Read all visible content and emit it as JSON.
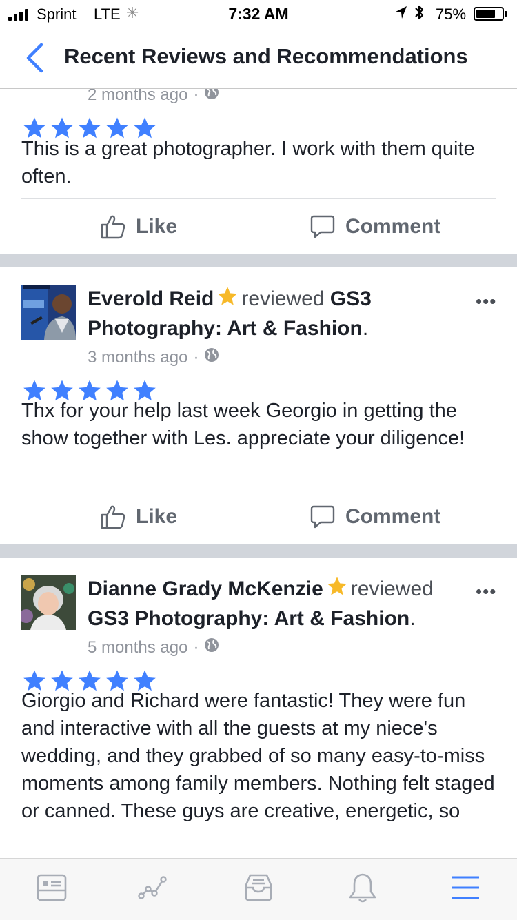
{
  "status_bar": {
    "carrier": "Sprint",
    "network": "LTE",
    "time": "7:32 AM",
    "battery_percent": "75%",
    "battery_level": 0.75,
    "icons": [
      "signal-icon",
      "activity-spinner-icon",
      "location-arrow-icon",
      "bluetooth-icon",
      "battery-icon"
    ]
  },
  "nav": {
    "title": "Recent Reviews and Recommendations",
    "back_icon": "chevron-left-icon"
  },
  "colors": {
    "accent": "#4080ff",
    "star_badge": "#f7b928",
    "separator": "#d1d5db",
    "muted_text": "#90949c",
    "action_text": "#616770"
  },
  "reviews": [
    {
      "time_ago": "2 months ago",
      "rating": 5,
      "text": "This is a great photographer. I work with them quite often.",
      "like_label": "Like",
      "comment_label": "Comment"
    },
    {
      "author": "Everold Reid",
      "verb": "reviewed",
      "page": "GS3 Photography: Art & Fashion",
      "time_ago": "3 months ago",
      "rating": 5,
      "text": "Thx for your help last week Georgio in getting the show together with Les. appreciate your diligence!",
      "like_label": "Like",
      "comment_label": "Comment"
    },
    {
      "author": "Dianne Grady McKenzie",
      "verb": "reviewed",
      "page": "GS3 Photography: Art & Fashion",
      "time_ago": "5 months ago",
      "rating": 5,
      "text": "Giorgio and Richard were fantastic! They were fun and interactive with all the guests at my niece's wedding, and they grabbed of so many easy-to-miss moments among family members. Nothing felt staged or canned. These guys are creative, energetic, so"
    }
  ],
  "tab_bar": {
    "tabs": [
      {
        "icon": "news-feed-icon",
        "active": false
      },
      {
        "icon": "insights-icon",
        "active": false
      },
      {
        "icon": "inbox-icon",
        "active": false
      },
      {
        "icon": "notifications-bell-icon",
        "active": false
      },
      {
        "icon": "menu-icon",
        "active": true
      }
    ]
  }
}
